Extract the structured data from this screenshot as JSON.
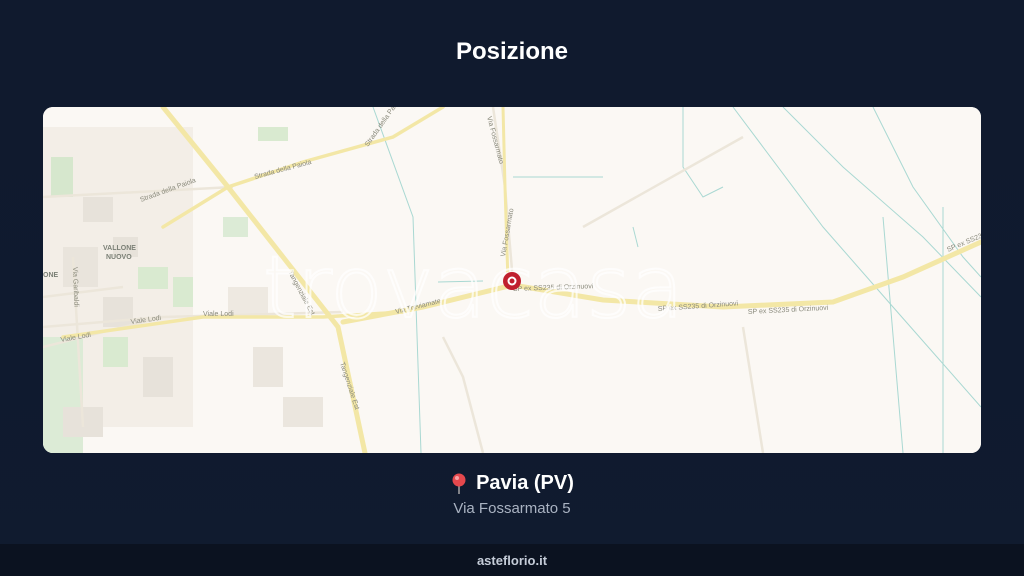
{
  "header": {
    "title": "Posizione"
  },
  "map": {
    "watermark": "trovacasa",
    "place_labels": {
      "vallone_1": "VALLONE",
      "vallone_2": "NUOVO",
      "one": "ONE"
    },
    "road_labels": {
      "strada_paiola_1": "Strada della Paiola",
      "strada_paiola_2": "Strada della Paiola",
      "strada_paiola_3": "Strada della Paiola",
      "via_fossarmato_1": "Via Fossarmato",
      "via_fossarmato_2": "Via Fossarmato",
      "via_treviamate": "Via Treviamate",
      "tangenziale_est_1": "Tangenziale Est",
      "tangenziale_est_2": "Tangenziale Est",
      "viale_lodi_1": "Viale Lodi",
      "viale_lodi_2": "Viale Lodi",
      "viale_lodi_3": "Viale Lodi",
      "sp_1": "SP ex SS235 di Orzinuovi",
      "sp_2": "SP ex SS235 di Orzinuovi",
      "sp_3": "SP ex SS235 di Orzinuovi",
      "sp_4": "SP ex SS235 di Orz",
      "via_garibaldi": "Via Garibaldi"
    },
    "colors": {
      "background": "#fbf8f4",
      "major_road": "#f3e7a6",
      "water": "#a9d8d2",
      "green": "#d9ead0",
      "marker": "#c0202e"
    }
  },
  "location": {
    "pin_icon": "round-pushpin-icon",
    "city": "Pavia (PV)",
    "address": "Via Fossarmato 5"
  },
  "footer": {
    "site": "asteflorio.it"
  }
}
